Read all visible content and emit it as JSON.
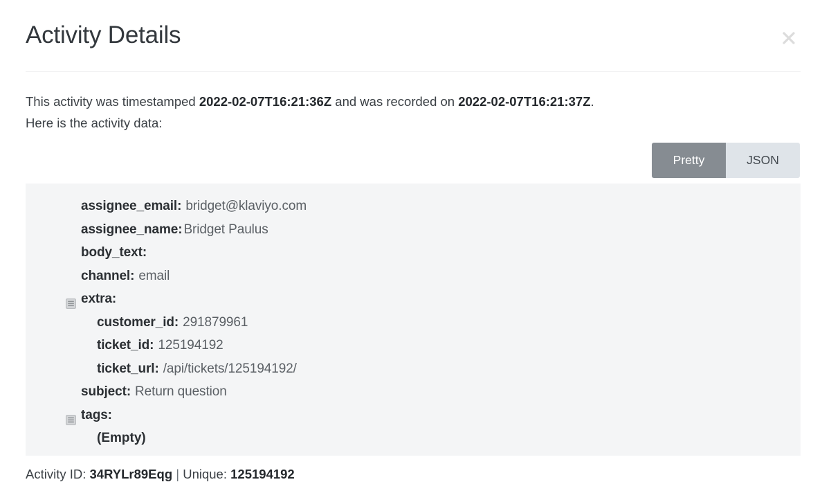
{
  "modal": {
    "title": "Activity Details",
    "close_icon": "close-icon"
  },
  "intro": {
    "prefix": "This activity was timestamped ",
    "timestamped": "2022-02-07T16:21:36Z",
    "middle": " and was recorded on ",
    "recorded": "2022-02-07T16:21:37Z",
    "suffix": ".",
    "line2": "Here is the activity data:"
  },
  "view_toggle": {
    "options": [
      {
        "label": "Pretty",
        "active": true
      },
      {
        "label": "JSON",
        "active": false
      }
    ],
    "active_label": "Pretty",
    "inactive_label": "JSON",
    "active_bg": "#868c92",
    "inactive_bg": "#dfe4e9"
  },
  "activity_data": {
    "panel_bg": "#f4f5f6",
    "rows": [
      {
        "key": "assignee_email:",
        "value": "bridget@klaviyo.com",
        "indent": 0,
        "toggle": false
      },
      {
        "key": "assignee_name:",
        "value": "Bridget Paulus",
        "indent": 0,
        "toggle": false
      },
      {
        "key": "body_text:",
        "value": "",
        "indent": 0,
        "toggle": false
      },
      {
        "key": "channel:",
        "value": "email",
        "indent": 0,
        "toggle": false
      },
      {
        "key": "extra:",
        "value": "",
        "indent": 0,
        "toggle": true
      },
      {
        "key": "customer_id:",
        "value": "291879961",
        "indent": 1,
        "toggle": false
      },
      {
        "key": "ticket_id:",
        "value": "125194192",
        "indent": 1,
        "toggle": false
      },
      {
        "key": "ticket_url:",
        "value": "/api/tickets/125194192/",
        "indent": 1,
        "toggle": false
      },
      {
        "key": "subject:",
        "value": "Return question",
        "indent": 0,
        "toggle": false
      },
      {
        "key": "tags:",
        "value": "",
        "indent": 0,
        "toggle": true
      },
      {
        "key": "(Empty)",
        "value": "",
        "indent": 1,
        "toggle": false,
        "empty": true
      }
    ]
  },
  "footer": {
    "activity_id_label": "Activity ID:",
    "activity_id": "34RYLr89Eqg",
    "separator": "|",
    "unique_label": "Unique:",
    "unique": "125194192"
  }
}
